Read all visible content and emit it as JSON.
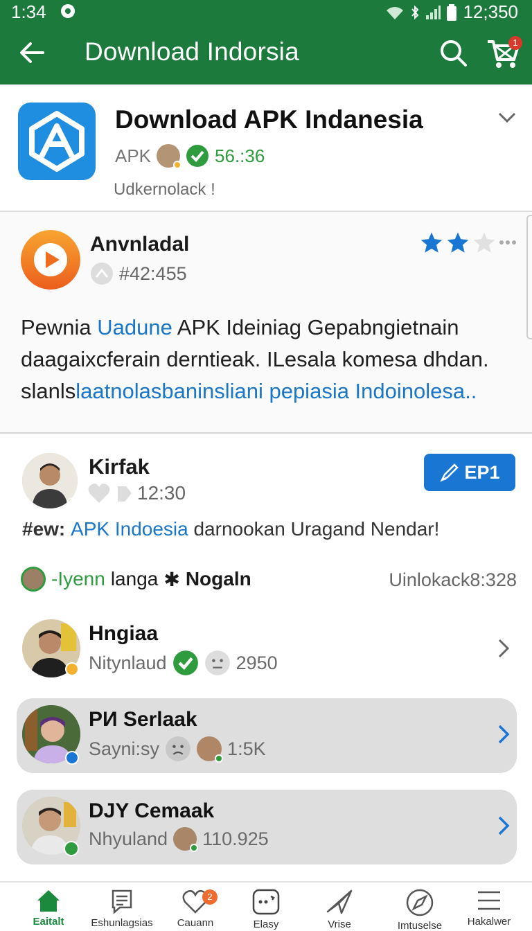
{
  "status_bar": {
    "time": "1:34",
    "right_text": "12;350"
  },
  "app_bar": {
    "title": "Download Indorsia",
    "cart_badge": "1"
  },
  "app_header": {
    "name": "Download APK Indanesia",
    "tag": "APK",
    "count": "56.:36",
    "subtitle": "Udkernolack !"
  },
  "featured": {
    "name": "Anvnladal",
    "rank": "#42:455",
    "rating": 2,
    "desc_lines": [
      {
        "a": "Pewnia ",
        "b": "Uadune",
        "c": " APK Ideiniag Gepabngietnain"
      },
      {
        "a": "daagaixcferain derntieak. ILesala komesa dhdan.",
        "b": "",
        "c": ""
      },
      {
        "a": "slanls",
        "b": "laatnolasbaninsliani pepiasia Indoinolesa..",
        "c": ""
      }
    ]
  },
  "post": {
    "name": "Kirfak",
    "time": "12:30",
    "button": "EP1",
    "body_prefix": "#ew: ",
    "body_link": "APK Indoesia",
    "body_rest": " darnookan Uragand Nendar!"
  },
  "tagline": {
    "green": "-Iyenn",
    "black": "langa",
    "bold": "Nogaln",
    "right": "Uinlokack8:328"
  },
  "rows": [
    {
      "name": "Hngiaa",
      "meta": "Nitynlaud",
      "value": "2950"
    },
    {
      "name": "PИ Serlaak",
      "meta": "Sayni:sy",
      "value": "1:5K"
    },
    {
      "name": "DJY Cemaak",
      "meta": "Nhyuland",
      "value": "110.925"
    }
  ],
  "nav": [
    {
      "label": "Eaitalt"
    },
    {
      "label": "Eshunlagsias"
    },
    {
      "label": "Cauann",
      "badge": "2"
    },
    {
      "label": "Elasy"
    },
    {
      "label": "Vrise"
    },
    {
      "label": "Imtuselse"
    },
    {
      "label": "Hakalwer"
    }
  ]
}
